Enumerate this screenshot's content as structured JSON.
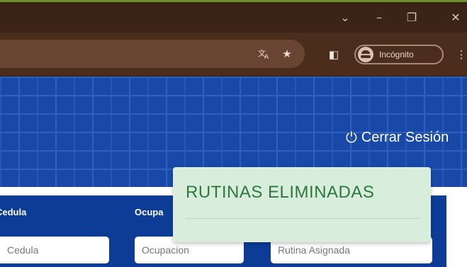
{
  "browser": {
    "controls": {
      "chevron": "⌄",
      "minimize": "–",
      "restore": "❐",
      "close": "✕"
    },
    "toolbar": {
      "translate_icon": "translate-icon",
      "bookmark_icon": "★",
      "sidepanel_icon": "◧",
      "incognito_label": "Incógnito",
      "menu_icon": "⋮"
    }
  },
  "banner": {
    "logout_icon": "⏻",
    "logout_label": "Cerrar Sesión"
  },
  "form": {
    "columns": [
      "Cedula",
      "Ocupa"
    ],
    "fields": {
      "cedula_placeholder": "Cedula",
      "ocupacion_placeholder": "Ocupacion",
      "rutina_placeholder": "Rutina Asignada"
    }
  },
  "toast": {
    "title": "RUTINAS ELIMINADAS"
  },
  "colors": {
    "banner_blue": "#1949a8",
    "form_blue": "#0d3c96",
    "toast_bg": "#d8eddc",
    "toast_text": "#2b7a3a"
  }
}
